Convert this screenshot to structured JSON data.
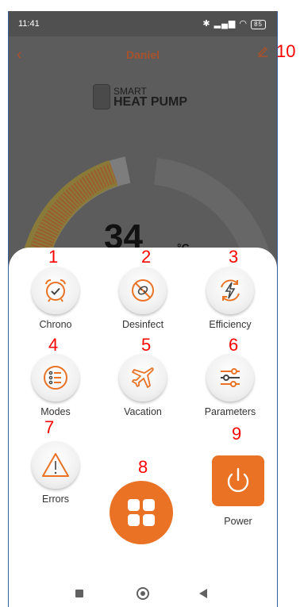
{
  "status": {
    "time": "11:41",
    "battery": "85"
  },
  "header": {
    "title": "Daniel"
  },
  "brand": {
    "line1": "SMART",
    "line2": "HEAT PUMP"
  },
  "gauge": {
    "temperature": "34",
    "unit": "°C"
  },
  "menu": {
    "chrono": "Chrono",
    "desinfect": "Desinfect",
    "efficiency": "Efficiency",
    "modes": "Modes",
    "vacation": "Vacation",
    "parameters": "Parameters",
    "errors": "Errors",
    "power": "Power"
  },
  "annotations": [
    "1",
    "2",
    "3",
    "4",
    "5",
    "6",
    "7",
    "8",
    "9",
    "10"
  ],
  "colors": {
    "accent": "#ea7225",
    "header_text": "#a8522c",
    "annotation": "#ff0000",
    "overlay": "#5c5c5c"
  },
  "icons": [
    "alarm-clock-icon",
    "bacteria-no-icon",
    "energy-cycle-icon",
    "list-icon",
    "airplane-icon",
    "sliders-icon",
    "warning-icon",
    "grid-icon",
    "power-icon",
    "edit-icon",
    "back-icon"
  ]
}
